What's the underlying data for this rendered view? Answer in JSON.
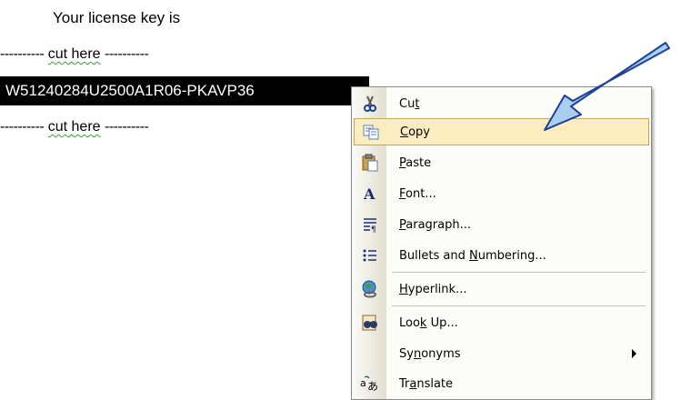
{
  "document": {
    "title": "Your license key is",
    "cut_line_top": {
      "dashes_left": "----------",
      "word": "cut here",
      "dashes_right": "----------"
    },
    "license_key": "W51240284U2500A1R06-PKAVP36",
    "cut_line_bottom": {
      "dashes_left": "----------",
      "word": "cut here",
      "dashes_right": "----------"
    }
  },
  "context_menu": {
    "items": [
      {
        "pre": "Cu",
        "key": "t",
        "post": "",
        "icon": "scissors-icon"
      },
      {
        "pre": "",
        "key": "C",
        "post": "opy",
        "icon": "copy-icon",
        "highlighted": true
      },
      {
        "pre": "",
        "key": "P",
        "post": "aste",
        "icon": "clipboard-paste-icon"
      },
      {
        "pre": "",
        "key": "F",
        "post": "ont...",
        "icon": "font-icon"
      },
      {
        "pre": "",
        "key": "P",
        "post": "aragraph...",
        "icon": "paragraph-icon"
      },
      {
        "pre": "Bullets and ",
        "key": "N",
        "post": "umbering...",
        "icon": "bullets-icon"
      },
      {
        "pre": "",
        "key": "H",
        "post": "yperlink...",
        "icon": "hyperlink-globe-icon"
      },
      {
        "pre": "Loo",
        "key": "k",
        "post": " Up...",
        "icon": "research-binoculars-icon"
      },
      {
        "pre": "Sy",
        "key": "n",
        "post": "onyms",
        "icon": "",
        "submenu": true
      },
      {
        "pre": "Tr",
        "key": "a",
        "post": "nslate",
        "icon": "translate-icon"
      }
    ]
  },
  "colors": {
    "highlight_bg": "#fcedc0",
    "highlight_border": "#c9a64a",
    "pointer_arrow": "#a8d0ee",
    "selection_bg": "#000000"
  }
}
